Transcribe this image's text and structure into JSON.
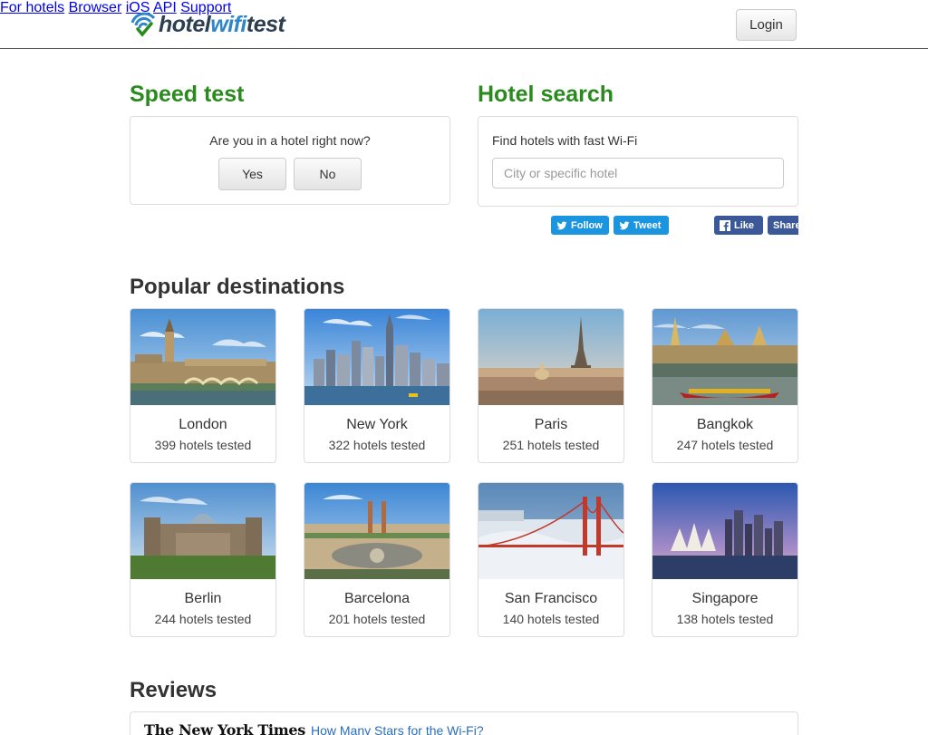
{
  "header": {
    "logo_part1": "hotel",
    "logo_part2": "wifi",
    "logo_part3": "test",
    "nav": [
      "For hotels",
      "Browser",
      "iOS",
      "API",
      "Support"
    ],
    "login_label": "Login"
  },
  "speed_test": {
    "title": "Speed test",
    "question": "Are you in a hotel right now?",
    "yes_label": "Yes",
    "no_label": "No"
  },
  "hotel_search": {
    "title": "Hotel search",
    "label": "Find hotels with fast Wi-Fi",
    "placeholder": "City or specific hotel",
    "value": ""
  },
  "social": {
    "follow_label": "Follow",
    "tweet_label": "Tweet",
    "like_label": "Like",
    "share_label": "Share"
  },
  "destinations": {
    "title": "Popular destinations",
    "items": [
      {
        "city": "London",
        "count": "399 hotels tested"
      },
      {
        "city": "New York",
        "count": "322 hotels tested"
      },
      {
        "city": "Paris",
        "count": "251 hotels tested"
      },
      {
        "city": "Bangkok",
        "count": "247 hotels tested"
      },
      {
        "city": "Berlin",
        "count": "244 hotels tested"
      },
      {
        "city": "Barcelona",
        "count": "201 hotels tested"
      },
      {
        "city": "San Francisco",
        "count": "140 hotels tested"
      },
      {
        "city": "Singapore",
        "count": "138 hotels tested"
      }
    ]
  },
  "reviews": {
    "title": "Reviews",
    "source": "The New York Times",
    "link_text": "How Many Stars for the Wi-Fi?"
  },
  "colors": {
    "accent_green": "#2a8a1e",
    "logo_blue": "#2f87c8",
    "twitter_blue": "#1b95e0",
    "facebook_blue": "#3b5998"
  }
}
